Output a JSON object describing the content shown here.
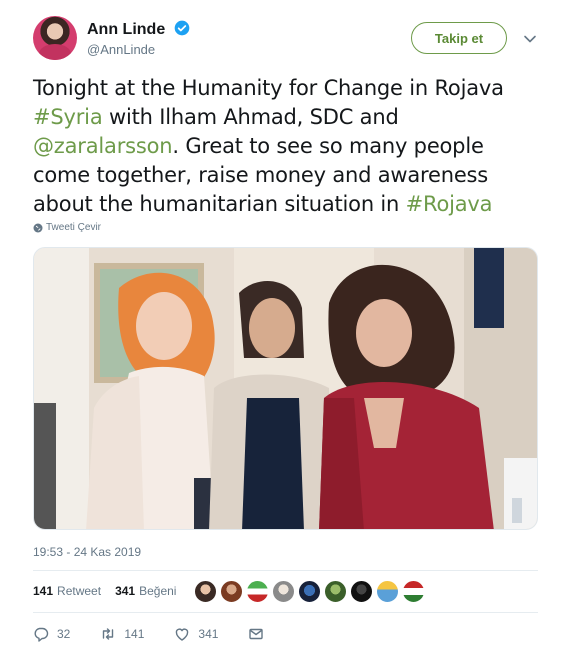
{
  "author": {
    "name": "Ann Linde",
    "handle": "@AnnLinde"
  },
  "follow_label": "Takip et",
  "tweet": {
    "part1": "Tonight at the Humanity for Change in Rojava ",
    "hashtag_syria": "#Syria",
    "part2": " with Ilham Ahmad, SDC and ",
    "mention_zara": "@zaralarsson",
    "part3": ". Great to see so many people come together, raise money and awareness about the humanitarian situation in ",
    "hashtag_rojava": "#Rojava"
  },
  "translate_label": "Tweeti Çevir",
  "timestamp": "19:53 - 24 Kas 2019",
  "stats": {
    "retweets_count": "141",
    "retweets_label": "Retweet",
    "likes_count": "341",
    "likes_label": "Beğeni"
  },
  "actions": {
    "reply_count": "32",
    "retweet_count": "141",
    "like_count": "341"
  },
  "colors": {
    "accent": "#6e9b4a",
    "verified": "#1da1f2",
    "muted": "#657786"
  },
  "likers_count_shown": 9
}
